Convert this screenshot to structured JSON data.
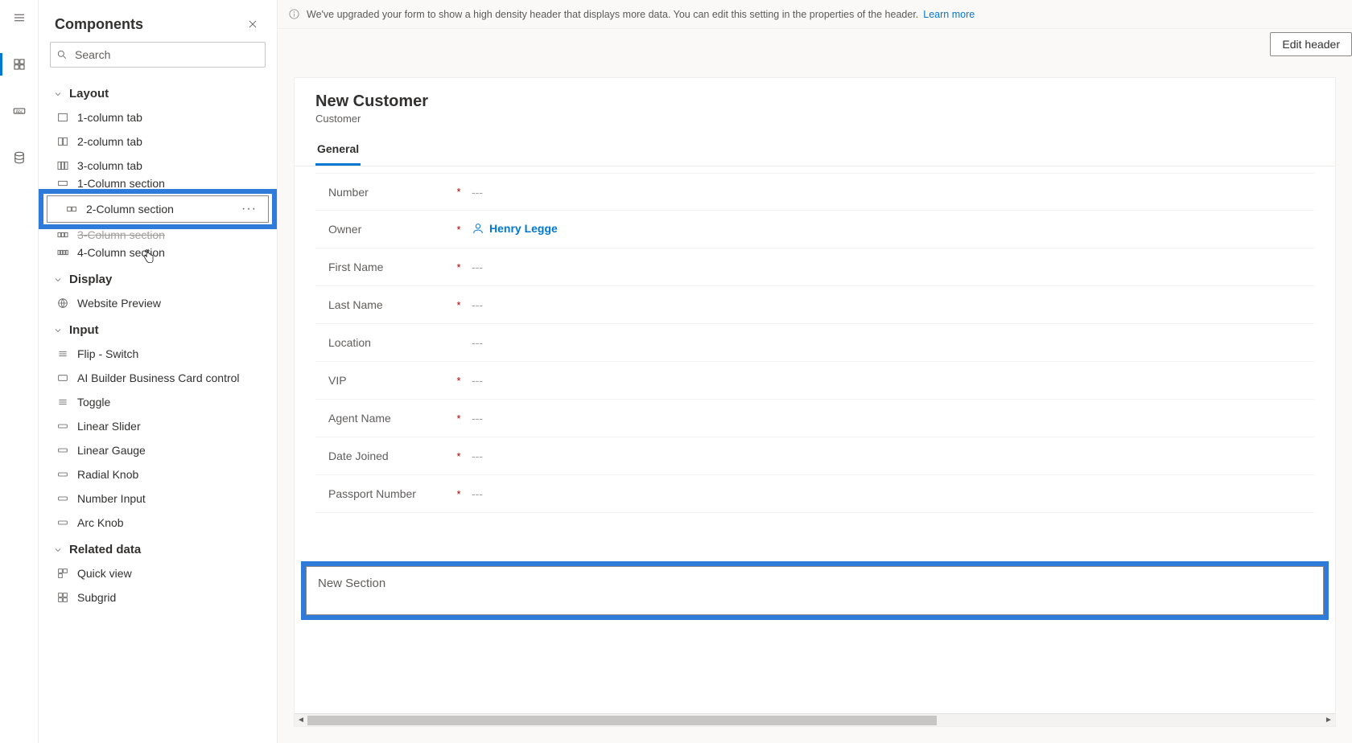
{
  "panel": {
    "title": "Components",
    "search_placeholder": "Search"
  },
  "groups": {
    "layout": {
      "label": "Layout",
      "items": [
        "1-column tab",
        "2-column tab",
        "3-column tab",
        "1-Column section",
        "2-Column section",
        "3-Column section",
        "4-Column section"
      ]
    },
    "display": {
      "label": "Display",
      "items": [
        "Website Preview"
      ]
    },
    "input": {
      "label": "Input",
      "items": [
        "Flip - Switch",
        "AI Builder Business Card control",
        "Toggle",
        "Linear Slider",
        "Linear Gauge",
        "Radial Knob",
        "Number Input",
        "Arc Knob"
      ]
    },
    "related": {
      "label": "Related data",
      "items": [
        "Quick view",
        "Subgrid"
      ]
    }
  },
  "more_label": "···",
  "info": {
    "text": "We've upgraded your form to show a high density header that displays more data. You can edit this setting in the properties of the header.",
    "link": "Learn more"
  },
  "edit_header_label": "Edit header",
  "form": {
    "title": "New Customer",
    "subtitle": "Customer",
    "tab": "General",
    "owner_name": "Henry Legge",
    "empty": "---",
    "fields": [
      {
        "label": "Number",
        "required": true,
        "type": "empty"
      },
      {
        "label": "Owner",
        "required": true,
        "type": "owner"
      },
      {
        "label": "First Name",
        "required": true,
        "type": "empty"
      },
      {
        "label": "Last Name",
        "required": true,
        "type": "empty"
      },
      {
        "label": "Location",
        "required": false,
        "type": "empty"
      },
      {
        "label": "VIP",
        "required": true,
        "type": "empty"
      },
      {
        "label": "Agent Name",
        "required": true,
        "type": "empty"
      },
      {
        "label": "Date Joined",
        "required": true,
        "type": "empty"
      },
      {
        "label": "Passport Number",
        "required": true,
        "type": "empty"
      }
    ],
    "new_section_label": "New Section"
  }
}
